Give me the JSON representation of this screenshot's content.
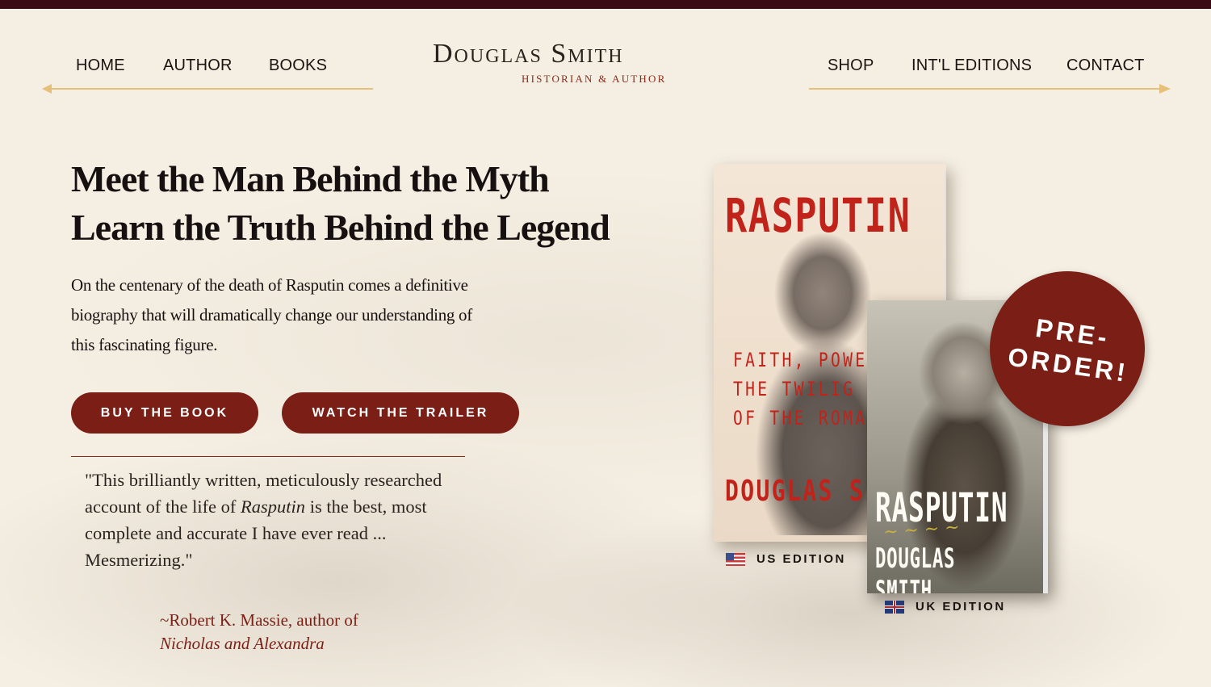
{
  "nav": {
    "left": [
      "HOME",
      "AUTHOR",
      "BOOKS"
    ],
    "right": [
      "SHOP",
      "INT'L EDITIONS",
      "CONTACT"
    ]
  },
  "logo": {
    "name": "Douglas Smith",
    "tagline": "HISTORIAN & AUTHOR"
  },
  "hero": {
    "headline_line1": "Meet the Man Behind the Myth",
    "headline_line2": "Learn the Truth Behind the Legend",
    "intro": "On the centenary of the death of Rasputin comes a definitive biography that will dramatically change our understanding of this fascinating figure.",
    "buttons": {
      "buy": "BUY THE BOOK",
      "trailer": "WATCH THE TRAILER"
    }
  },
  "quote": {
    "part1": "\"This brilliantly written, meticulously researched account of the life of ",
    "emphasis": "Rasputin",
    "part2": " is the best, most complete and accurate I have ever read ... Mesmerizing.\"",
    "attribution": "~Robert K. Massie, author of",
    "source": "Nicholas and Alexandra"
  },
  "books": {
    "us": {
      "title": "RASPUTIN",
      "subtitle_lines": [
        "FAITH, POWER",
        "THE TWILIG",
        "OF THE ROMA"
      ],
      "author": "DOUGLAS SI",
      "edition_label": "US EDITION"
    },
    "uk": {
      "title": "RASPUTIN",
      "author": "DOUGLAS SMITH",
      "edition_label": "UK EDITION"
    }
  },
  "badge": {
    "line1": "PRE-",
    "line2": "ORDER!"
  },
  "colors": {
    "accent": "#7b1f16",
    "topbar": "#3a0a14",
    "nav_rule": "#e6c078",
    "background": "#f5efe3"
  }
}
